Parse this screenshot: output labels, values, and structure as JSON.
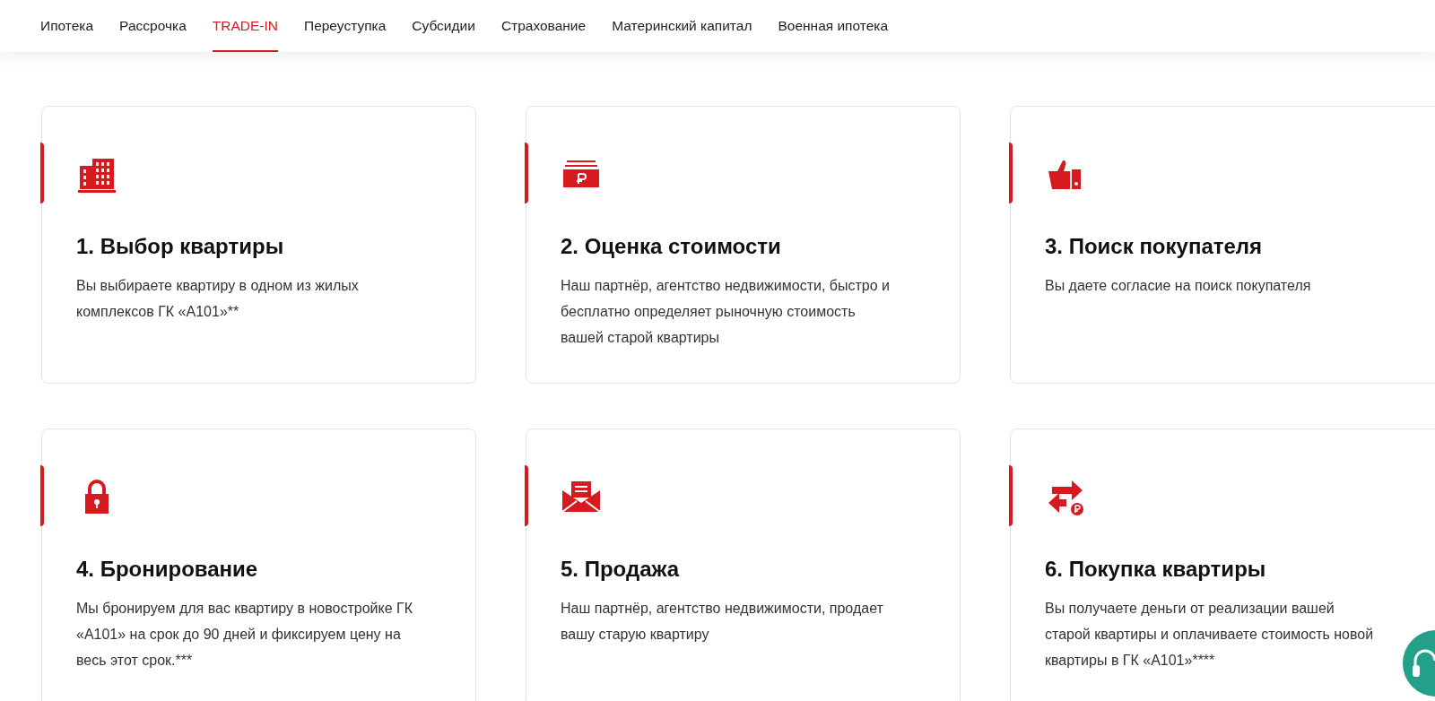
{
  "nav": {
    "items": [
      {
        "label": "Ипотека",
        "selected": false
      },
      {
        "label": "Рассрочка",
        "selected": false
      },
      {
        "label": "TRADE-IN",
        "selected": true
      },
      {
        "label": "Переуступка",
        "selected": false
      },
      {
        "label": "Субсидии",
        "selected": false
      },
      {
        "label": "Страхование",
        "selected": false
      },
      {
        "label": "Материнский капитал",
        "selected": false
      },
      {
        "label": "Военная ипотека",
        "selected": false
      }
    ]
  },
  "steps": [
    {
      "kind": "building",
      "title": "1. Выбор квартиры",
      "text": "Вы выбираете квартиру в одном из жилых комплексов ГК «А101»**"
    },
    {
      "kind": "money",
      "title": "2. Оценка стоимости",
      "text": "Наш партнёр, агентство недвижимости, быстро и бесплатно определяет рыночную стоимость вашей старой квартиры"
    },
    {
      "kind": "thumb",
      "title": "3. Поиск покупателя",
      "text": "Вы даете согласие на поиск покупателя"
    },
    {
      "kind": "lock",
      "title": "4. Бронирование",
      "text": "Мы бронируем для вас квартиру в новостройке ГК «А101» на срок до 90 дней и фиксируем цену на весь этот срок.***"
    },
    {
      "kind": "envelope",
      "title": "5. Продажа",
      "text": "Наш партнёр, агентство недвижимости, продает вашу старую квартиру"
    },
    {
      "kind": "exchange",
      "title": "6. Покупка квартиры",
      "text": "Вы получаете деньги от реализации вашей старой квартиры и оплачиваете стоимость новой квартиры в ГК «А101»****"
    }
  ]
}
